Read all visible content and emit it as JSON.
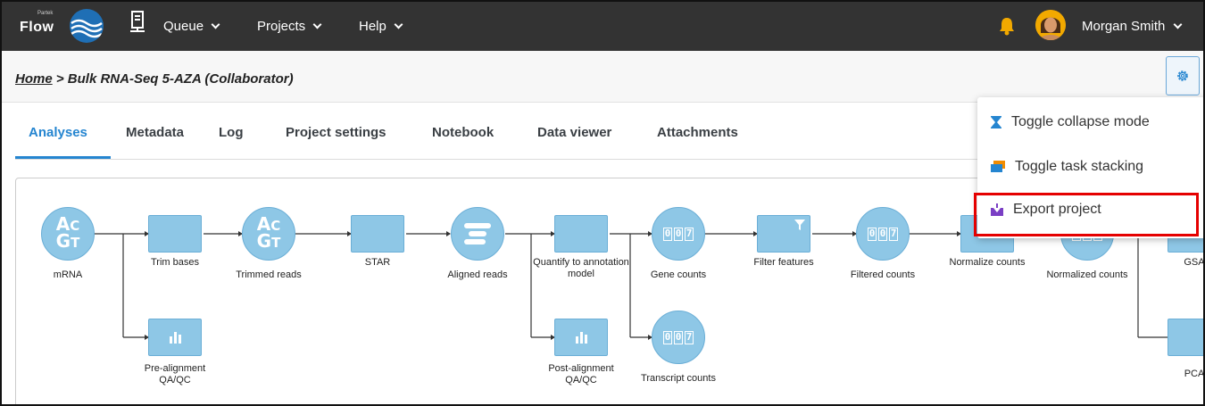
{
  "app": {
    "logo_text": "Flow",
    "logo_small_text": "Partek"
  },
  "nav": {
    "items": [
      {
        "label": "Queue"
      },
      {
        "label": "Projects"
      },
      {
        "label": "Help"
      }
    ],
    "user_name": "Morgan Smith"
  },
  "breadcrumb": {
    "home": "Home",
    "separator": " > ",
    "current": "Bulk RNA-Seq 5-AZA (Collaborator)"
  },
  "tabs": [
    {
      "label": "Analyses",
      "active": true
    },
    {
      "label": "Metadata"
    },
    {
      "label": "Log"
    },
    {
      "label": "Project settings"
    },
    {
      "label": "Notebook"
    },
    {
      "label": "Data viewer"
    },
    {
      "label": "Attachments"
    }
  ],
  "pipeline": {
    "nodes": [
      {
        "label": "mRNA",
        "kind": "data",
        "icon": "acgt-icon"
      },
      {
        "label": "Trim bases",
        "kind": "task"
      },
      {
        "label": "Trimmed reads",
        "kind": "data",
        "icon": "acgt-icon"
      },
      {
        "label": "STAR",
        "kind": "task"
      },
      {
        "label": "Aligned reads",
        "kind": "data",
        "icon": "aligned-reads-icon"
      },
      {
        "label": "Quantify to annotation model",
        "kind": "task"
      },
      {
        "label": "Gene counts",
        "kind": "data",
        "icon": "counter-icon"
      },
      {
        "label": "Filter features",
        "kind": "task",
        "icon": "filter-icon"
      },
      {
        "label": "Filtered counts",
        "kind": "data",
        "icon": "counter-icon"
      },
      {
        "label": "Normalize counts",
        "kind": "task"
      },
      {
        "label": "Normalized counts",
        "kind": "data",
        "icon": "counter-icon"
      },
      {
        "label": "GSA",
        "kind": "task"
      },
      {
        "label": "Pre-alignment QA/QC",
        "kind": "task",
        "icon": "bar-chart-icon"
      },
      {
        "label": "Post-alignment QA/QC",
        "kind": "task",
        "icon": "bar-chart-icon"
      },
      {
        "label": "Transcript counts",
        "kind": "data",
        "icon": "counter-icon"
      },
      {
        "label": "PCA",
        "kind": "task"
      }
    ],
    "counter_glyphs": [
      "0",
      "0",
      "7"
    ]
  },
  "menu": {
    "items": [
      {
        "label": "Toggle collapse mode",
        "icon": "hourglass-icon"
      },
      {
        "label": "Toggle task stacking",
        "icon": "stack-icon"
      },
      {
        "label": "Export project",
        "icon": "export-icon",
        "highlighted": true
      }
    ]
  },
  "colors": {
    "topbar": "#333333",
    "accent": "#2585d0",
    "node_fill": "#8ec7e6",
    "highlight": "#e50000"
  }
}
